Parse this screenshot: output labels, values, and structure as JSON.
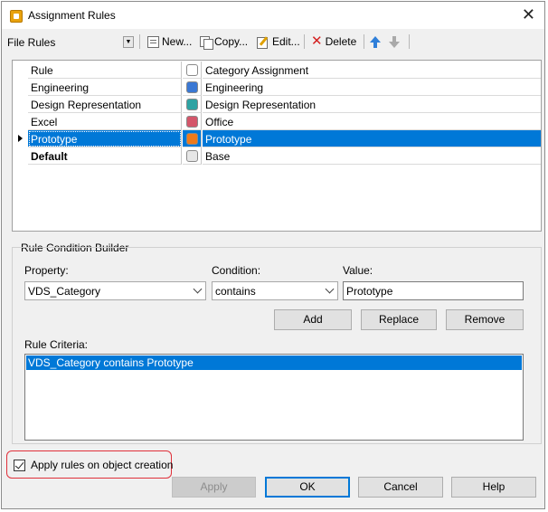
{
  "window": {
    "title": "Assignment Rules"
  },
  "toolbar": {
    "combo_value": "File Rules",
    "new_label": "New...",
    "copy_label": "Copy...",
    "edit_label": "Edit...",
    "delete_label": "Delete"
  },
  "grid": {
    "header": {
      "rule": "Rule",
      "category": "Category Assignment"
    },
    "rows": [
      {
        "rule": "Engineering",
        "category": "Engineering",
        "color": "#3b78d4",
        "bold": false,
        "selected": false
      },
      {
        "rule": "Design Representation",
        "category": "Design Representation",
        "color": "#2ea3a3",
        "bold": false,
        "selected": false
      },
      {
        "rule": "Excel",
        "category": "Office",
        "color": "#d4566a",
        "bold": false,
        "selected": false
      },
      {
        "rule": "Prototype",
        "category": "Prototype",
        "color": "#f07a1a",
        "bold": false,
        "selected": true
      },
      {
        "rule": "Default",
        "category": "Base",
        "color": "#e6e6e6",
        "bold": true,
        "selected": false
      }
    ]
  },
  "builder": {
    "group_label": "Rule Condition Builder",
    "property_label": "Property:",
    "property_value": "VDS_Category",
    "condition_label": "Condition:",
    "condition_value": "contains",
    "value_label": "Value:",
    "value_value": "Prototype",
    "add_label": "Add",
    "replace_label": "Replace",
    "remove_label": "Remove",
    "criteria_label": "Rule Criteria:",
    "criteria_items": [
      "VDS_Category contains Prototype"
    ]
  },
  "footer": {
    "apply_on_creation_label": "Apply rules on object creation",
    "apply_on_creation_checked": true,
    "apply_label": "Apply",
    "ok_label": "OK",
    "cancel_label": "Cancel",
    "help_label": "Help"
  }
}
